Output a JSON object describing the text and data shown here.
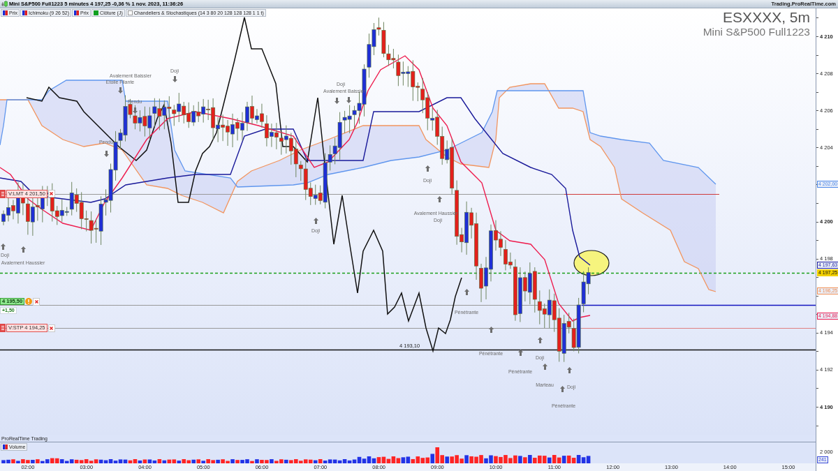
{
  "title_bar": {
    "title": "Mini S&P500 Full1223 5 minutes 4 197,25 -0,36 % 1 nov. 2023, 11:36:26",
    "site": "Trading.ProRealTime.com"
  },
  "legend": [
    {
      "label": "Prix",
      "kind": "price"
    },
    {
      "label": "Ichimoku (9 26 52)",
      "kind": "price"
    },
    {
      "label": "Prix",
      "kind": "price"
    },
    {
      "label": "Clôture (J)",
      "kind": "close"
    },
    {
      "label": "Chandeliers & Stochastiques (14 3 80 20 128 128 128 1 1 t)",
      "kind": "toggle",
      "checked": false
    }
  ],
  "chart": {
    "symbol": "ESXXXX, 5m",
    "instrument": "Mini S&P500 Full1223",
    "orders": [
      {
        "kind": "limit",
        "label": "V:LMT 4 201,50"
      },
      {
        "kind": "position",
        "label": "4 195,50",
        "change": "+1,50"
      },
      {
        "kind": "stop",
        "label": "V:STP 4 194,25"
      }
    ],
    "level_label": "4 193,10",
    "patterns": [
      "Doji",
      "Avalement Baissier",
      "Etoile Filante",
      "Doji",
      "Avalement Baissier",
      "Pendu",
      "Pendu",
      "Doji",
      "Avalement Haussier",
      "Doji",
      "Doji",
      "Doji",
      "Avalement Haussier",
      "Pénétrante",
      "Pénétrante",
      "Doji",
      "Pénétrante",
      "Marteau",
      "Doji",
      "Pénétrante"
    ]
  },
  "price_axis": {
    "ticks": [
      {
        "label": "4 210",
        "major": true
      },
      {
        "label": "4 208",
        "major": false
      },
      {
        "label": "4 206",
        "major": false
      },
      {
        "label": "4 204",
        "major": false
      },
      {
        "label": "4 200",
        "major": true
      },
      {
        "label": "4 198",
        "major": false
      },
      {
        "label": "4 194",
        "major": false
      },
      {
        "label": "4 192",
        "major": false
      },
      {
        "label": "4 190",
        "major": true
      }
    ],
    "tags": [
      {
        "label": "4 202,00",
        "kind": "outline",
        "color": "#4a86e8"
      },
      {
        "label": "4 197,63",
        "kind": "outline",
        "color": "#1a1aa0"
      },
      {
        "label": "4 197,25",
        "kind": "filled",
        "color": "#f2d000"
      },
      {
        "label": "4 196,25",
        "kind": "outline",
        "color": "#f08c50"
      },
      {
        "label": "4 194,88",
        "kind": "outline",
        "color": "#e8174f"
      }
    ]
  },
  "volume": {
    "title": "ProRealTime Trading",
    "legend": "Volume",
    "tick": "2 000",
    "reading": "241"
  },
  "time_axis": [
    "02:00",
    "03:00",
    "04:00",
    "05:00",
    "06:00",
    "07:00",
    "08:00",
    "09:00",
    "10:00",
    "11:00",
    "12:00",
    "13:00",
    "14:00",
    "15:00"
  ]
}
